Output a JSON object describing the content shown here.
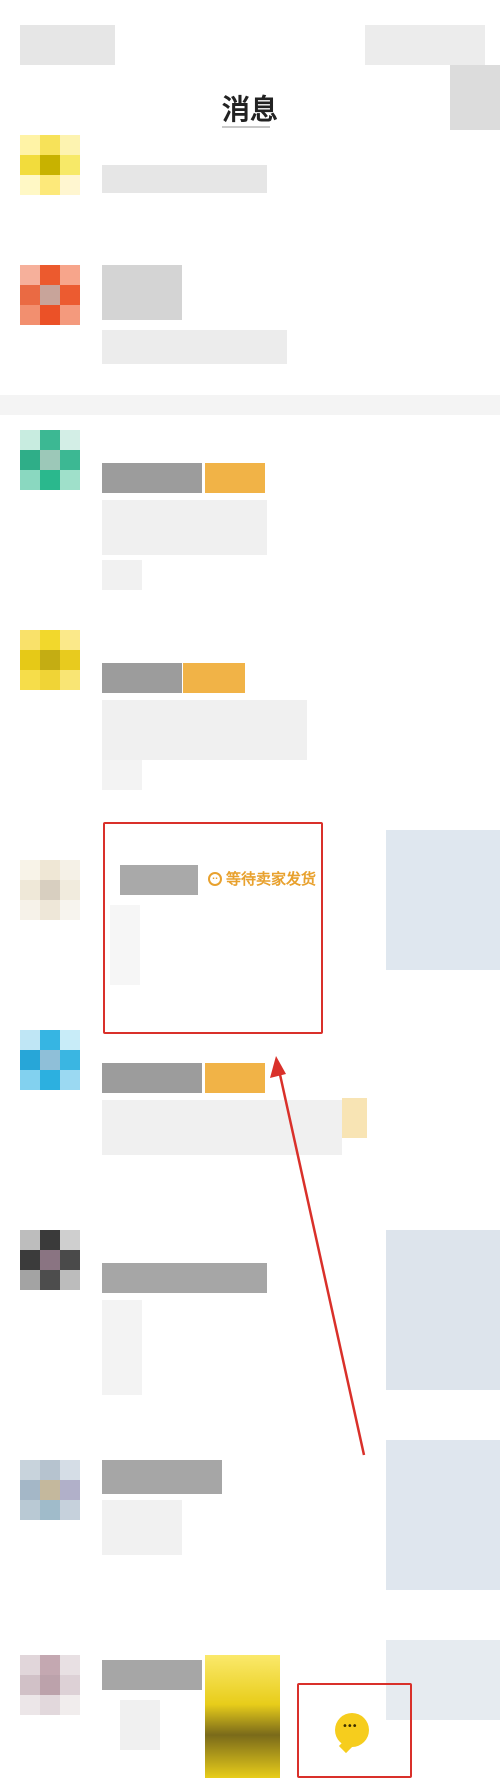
{
  "header": {
    "title": "消息"
  },
  "order_status": {
    "label": "等待卖家发货",
    "icon": "clock-icon"
  },
  "bottom_nav": {
    "chat_icon": "chat-bubble-icon"
  },
  "colors": {
    "accent_yellow": "#f6cd1d",
    "status_orange": "#e8a12e",
    "highlight_red": "#d9302a"
  }
}
